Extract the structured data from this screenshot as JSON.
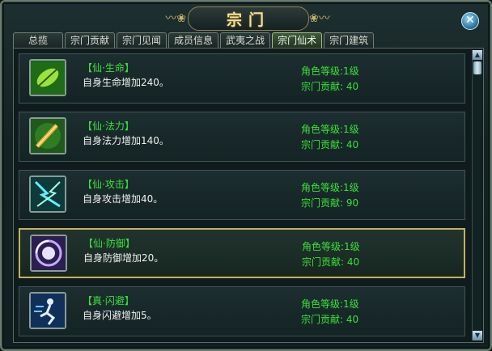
{
  "window": {
    "title": "宗门",
    "close_symbol": "✕"
  },
  "tabs": [
    {
      "label": "总揽",
      "active": false
    },
    {
      "label": "宗门贡献",
      "active": false
    },
    {
      "label": "宗门见闻",
      "active": false
    },
    {
      "label": "成员信息",
      "active": false
    },
    {
      "label": "武夷之战",
      "active": false
    },
    {
      "label": "宗门仙术",
      "active": true
    },
    {
      "label": "宗门建筑",
      "active": false
    }
  ],
  "skills": [
    {
      "name": "【仙·生命】",
      "desc": "自身生命增加240。",
      "req_level": "角色等级:1级",
      "req_contrib": "宗门贡献: 40",
      "icon": "leaf-icon",
      "selected": false
    },
    {
      "name": "【仙·法力】",
      "desc": "自身法力增加140。",
      "req_level": "角色等级:1级",
      "req_contrib": "宗门贡献: 40",
      "icon": "sword-icon",
      "selected": false
    },
    {
      "name": "【仙·攻击】",
      "desc": "自身攻击增加40。",
      "req_level": "角色等级:1级",
      "req_contrib": "宗门贡献: 90",
      "icon": "lightning-icon",
      "selected": false
    },
    {
      "name": "【仙·防御】",
      "desc": "自身防御增加20。",
      "req_level": "角色等级:1级",
      "req_contrib": "宗门贡献: 40",
      "icon": "shield-orb-icon",
      "selected": true
    },
    {
      "name": "【真·闪避】",
      "desc": "自身闪避增加5。",
      "req_level": "角色等级:1级",
      "req_contrib": "宗门贡献: 40",
      "icon": "dodge-runner-icon",
      "selected": false
    }
  ],
  "scrollbar": {
    "up_symbol": "▲",
    "down_symbol": "▼"
  },
  "colors": {
    "skill_name": "#38e238",
    "requirement": "#38e238",
    "title": "#f4e39a",
    "selected_border": "#c4b25a"
  }
}
